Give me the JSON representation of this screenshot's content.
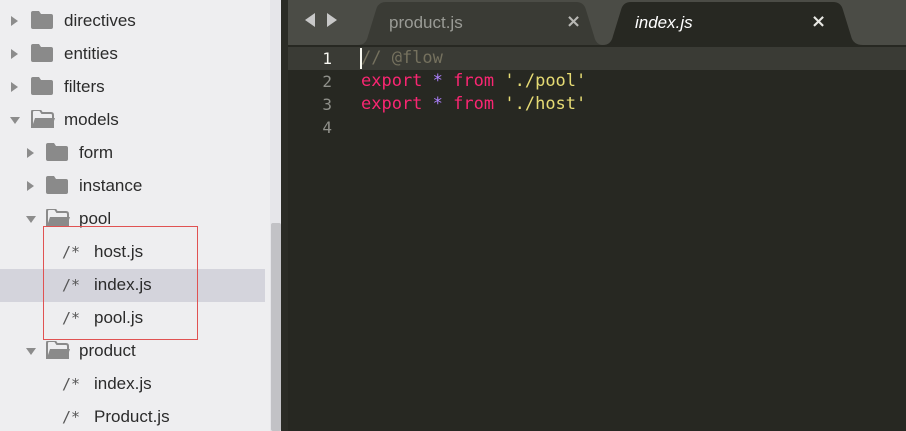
{
  "sidebar": {
    "items": [
      {
        "label": "directives",
        "kind": "folder",
        "state": "collapsed"
      },
      {
        "label": "entities",
        "kind": "folder",
        "state": "collapsed"
      },
      {
        "label": "filters",
        "kind": "folder",
        "state": "collapsed"
      },
      {
        "label": "models",
        "kind": "folder",
        "state": "expanded"
      },
      {
        "label": "form",
        "kind": "folder",
        "state": "collapsed"
      },
      {
        "label": "instance",
        "kind": "folder",
        "state": "collapsed"
      },
      {
        "label": "pool",
        "kind": "folder",
        "state": "expanded"
      },
      {
        "label": "host.js",
        "kind": "file",
        "glyph": "/*"
      },
      {
        "label": "index.js",
        "kind": "file",
        "glyph": "/*",
        "selected": true
      },
      {
        "label": "pool.js",
        "kind": "file",
        "glyph": "/*"
      },
      {
        "label": "product",
        "kind": "folder",
        "state": "expanded"
      },
      {
        "label": "index.js",
        "kind": "file",
        "glyph": "/*"
      },
      {
        "label": "Product.js",
        "kind": "file",
        "glyph": "/*"
      }
    ]
  },
  "tabs": [
    {
      "label": "product.js",
      "close": "×",
      "active": false
    },
    {
      "label": "index.js",
      "close": "×",
      "active": true
    }
  ],
  "editor": {
    "line_numbers": [
      "1",
      "2",
      "3",
      "4"
    ],
    "lines": {
      "l1": {
        "comment": "// @flow"
      },
      "l2": {
        "kw1": "export",
        "star": "*",
        "kw2": "from",
        "str": "'./pool'"
      },
      "l3": {
        "kw1": "export",
        "star": "*",
        "kw2": "from",
        "str": "'./host'"
      }
    }
  },
  "colors": {
    "keyword": "#f92672",
    "string": "#e6db74",
    "comment": "#75715e",
    "operator": "#ae81ff",
    "highlight_box": "#e05252"
  },
  "icons": {
    "folder": "folder-icon",
    "folder_open": "folder-open-icon",
    "collapsed": "chevron-right-icon",
    "expanded": "chevron-down-icon",
    "nav_back": "arrow-left-icon",
    "nav_forward": "arrow-right-icon"
  }
}
